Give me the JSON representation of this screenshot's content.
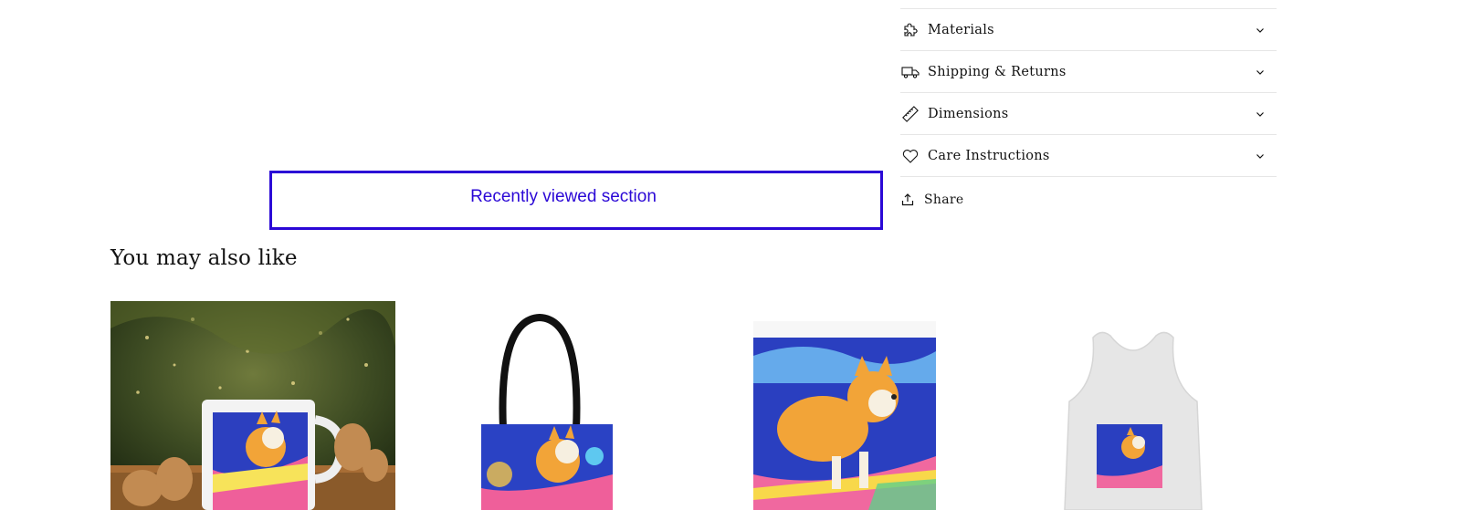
{
  "accordion": [
    {
      "label": "Materials",
      "icon": "puzzle-icon"
    },
    {
      "label": "Shipping & Returns",
      "icon": "truck-icon"
    },
    {
      "label": "Dimensions",
      "icon": "ruler-icon"
    },
    {
      "label": "Care Instructions",
      "icon": "heart-icon"
    }
  ],
  "share": {
    "label": "Share",
    "icon": "share-icon"
  },
  "recently_viewed": {
    "label": "Recently viewed section",
    "color": "#2b08d6"
  },
  "related": {
    "heading": "You may also like",
    "products": [
      {
        "image": "corgi-mug-image"
      },
      {
        "image": "corgi-tote-bag-image"
      },
      {
        "image": "corgi-garden-flag-image"
      },
      {
        "image": "corgi-tank-top-image"
      }
    ]
  }
}
